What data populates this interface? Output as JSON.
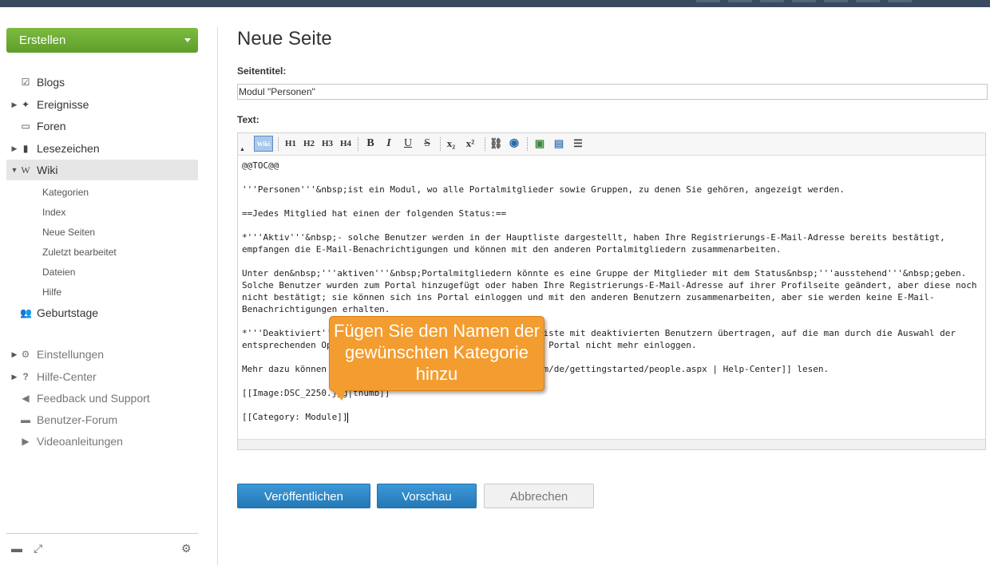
{
  "sidebar": {
    "create_label": "Erstellen",
    "items": [
      {
        "label": "Blogs",
        "icon": "edit-icon"
      },
      {
        "label": "Ereignisse",
        "icon": "pin-icon"
      },
      {
        "label": "Foren",
        "icon": "chat-icon"
      },
      {
        "label": "Lesezeichen",
        "icon": "bookmark-icon"
      },
      {
        "label": "Wiki",
        "icon": "wiki-icon"
      },
      {
        "label": "Geburtstage",
        "icon": "people-icon"
      },
      {
        "label": "Einstellungen",
        "icon": "gear-icon"
      },
      {
        "label": "Hilfe-Center",
        "icon": "question-icon"
      },
      {
        "label": "Feedback und Support",
        "icon": "megaphone-icon"
      },
      {
        "label": "Benutzer-Forum",
        "icon": "comment-icon"
      },
      {
        "label": "Videoanleitungen",
        "icon": "play-icon"
      }
    ],
    "wiki_sub": [
      "Kategorien",
      "Index",
      "Neue Seiten",
      "Zuletzt bearbeitet",
      "Dateien",
      "Hilfe"
    ]
  },
  "main": {
    "title": "Neue Seite",
    "page_title_label": "Seitentitel:",
    "page_title_value": "Modul \"Personen\"",
    "text_label": "Text:",
    "toolbar": {
      "h1": "H1",
      "h2": "H2",
      "h3": "H3",
      "h4": "H4",
      "bold": "B",
      "italic": "I",
      "underline": "U",
      "strike": "S",
      "sub": "x₂",
      "sup": "x²"
    },
    "content": {
      "line1": "@@TOC@@",
      "line2": "'''Personen'''&nbsp;ist ein Modul, wo alle Portalmitglieder sowie Gruppen, zu denen Sie gehören, angezeigt werden.",
      "line3": "==Jedes Mitglied hat einen der folgenden Status:==",
      "line4": "*'''Aktiv'''&nbsp;- solche Benutzer werden in der Hauptliste dargestellt, haben Ihre Registrierungs-E-Mail-Adresse bereits bestätigt, empfangen die E-Mail-Benachrichtigungen und können mit den anderen Portalmitgliedern zusammenarbeiten.",
      "line5": "Unter den&nbsp;'''aktiven'''&nbsp;Portalmitgliedern könnte es eine Gruppe der Mitglieder mit dem Status&nbsp;'''ausstehend'''&nbsp;geben. Solche Benutzer wurden zum Portal hinzugefügt oder haben Ihre Registrierungs-E-Mail-Adresse auf ihrer Profilseite geändert, aber diese noch nicht bestätigt; sie können sich ins Portal einloggen und mit den anderen Benutzern zusammenarbeiten, aber sie werden keine E-Mail-Benachrichtigungen erhalten.",
      "line6": "*'''Deaktiviert'''&nbsp;- solche Benutzer werden in die Liste mit deaktivierten Benutzern übertragen, auf die man durch die Auswahl der entsprechenden Option zugreifen kann; sie können sich ins Portal nicht mehr einloggen.",
      "line7": "Mehr dazu können Sie im [[http://helpcenter.onlyoffice.com/de/gettingstarted/people.aspx | Help-Center]] lesen.",
      "line8": "[[Image:DSC_2250.jpg|thumb]]",
      "line9": "[[Category: Module]]"
    },
    "callout": "Fügen Sie den Namen der gewünschten Kategorie hinzu",
    "buttons": {
      "publish": "Veröffentlichen",
      "preview": "Vorschau",
      "cancel": "Abbrechen"
    }
  },
  "colors": {
    "create": "#6aac33",
    "primary": "#2b84c4",
    "callout": "#f39c2f"
  }
}
